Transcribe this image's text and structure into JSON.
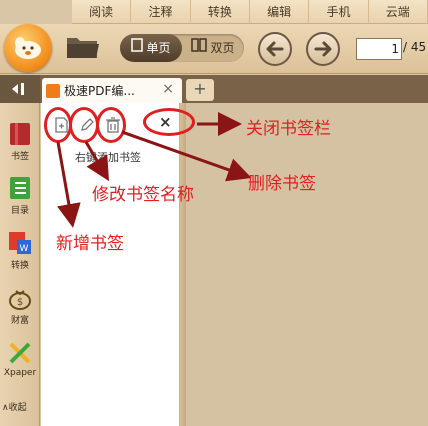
{
  "menu": {
    "tabs": [
      "阅读",
      "注释",
      "转换",
      "编辑",
      "手机",
      "云端"
    ]
  },
  "toolbar": {
    "single_page": "单页",
    "double_page": "双页",
    "page_current": "1",
    "page_total": "/ 45"
  },
  "sidebar": {
    "items": [
      {
        "label": "书签",
        "icon": "bookmark-icon"
      },
      {
        "label": "目录",
        "icon": "list-icon"
      },
      {
        "label": "转换",
        "icon": "pdf-word-icon"
      },
      {
        "label": "财富",
        "icon": "money-bag-icon"
      },
      {
        "label": "Xpaper",
        "icon": "xpaper-icon"
      }
    ],
    "fold_label": "收起"
  },
  "tab": {
    "title": "极速PDF编...",
    "close": "×",
    "new": "+"
  },
  "bookmark_panel": {
    "hint": "右键添加书签",
    "close": "×"
  },
  "annotations": {
    "close_panel": "关闭书签栏",
    "delete": "删除书签",
    "rename": "修改书签名称",
    "add": "新增书签"
  },
  "colors": {
    "annotation": "#e02020",
    "accent": "#f08a18"
  }
}
